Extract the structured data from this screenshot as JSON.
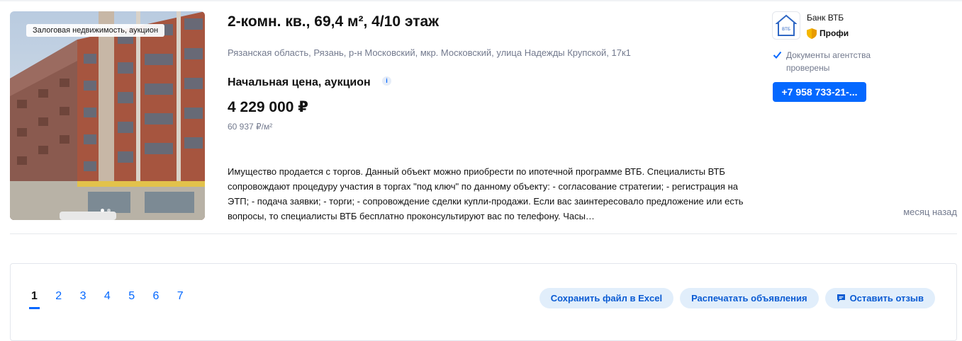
{
  "listing": {
    "photo_badge": "Залоговая недвижимость, аукцион",
    "title": "2-комн. кв., 69,4 м², 4/10 этаж",
    "address": "Рязанская область, Рязань, р-н Московский, мкр. Московский, улица Надежды Крупской, 17к1",
    "price_label": "Начальная цена, аукцион",
    "price": "4 229 000 ₽",
    "price_per_m2": "60 937 ₽/м²",
    "description": "Имущество продается с торгов. Данный объект можно приобрести по ипотечной программе ВТБ. Специалисты ВТБ сопровождают процедуру участия в торгах \"под ключ\" по данному объекту: - согласование стратегии; - регистрация на ЭТП; - подача заявки; - торги; - сопровождение сделки купли-продажи. Если вас заинтересовало предложение или есть вопросы, то специалисты ВТБ бесплатно проконсультируют вас по телефону. Часы…",
    "posted": "месяц назад",
    "photo_count": 2,
    "active_photo": 1
  },
  "agent": {
    "name": "Банк ВТБ",
    "badge": "Профи",
    "verified_text": "Документы агентства проверены",
    "phone_button": "+7 958 733-21-..."
  },
  "pagination": {
    "pages": [
      "1",
      "2",
      "3",
      "4",
      "5",
      "6",
      "7"
    ],
    "current": "1"
  },
  "actions": {
    "excel": "Сохранить файл в Excel",
    "print": "Распечатать объявления",
    "feedback": "Оставить отзыв"
  },
  "colors": {
    "accent": "#0468ff",
    "muted_text": "#737a8e",
    "button_bg": "#e1eefb"
  }
}
